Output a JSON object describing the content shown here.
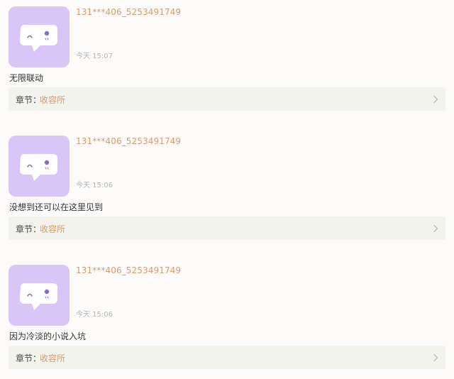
{
  "comments": [
    {
      "username": "131***406_5253491749",
      "time": "今天 15:07",
      "text": "无限联动",
      "chapter_label": "章节：",
      "chapter_name": "收容所"
    },
    {
      "username": "131***406_5253491749",
      "time": "今天 15:06",
      "text": "没想到还可以在这里见到",
      "chapter_label": "章节：",
      "chapter_name": "收容所"
    },
    {
      "username": "131***406_5253491749",
      "time": "今天 15:06",
      "text": "因为冷淡的小说入坑",
      "chapter_label": "章节：",
      "chapter_name": "收容所"
    }
  ],
  "icons": {
    "avatar": "chat-bubble-face-icon",
    "chevron": "chevron-right-icon"
  },
  "colors": {
    "avatar_bg": "#d9c6f7",
    "accent": "#d99a6c",
    "chapter_bar_bg": "#f3f3ee"
  }
}
